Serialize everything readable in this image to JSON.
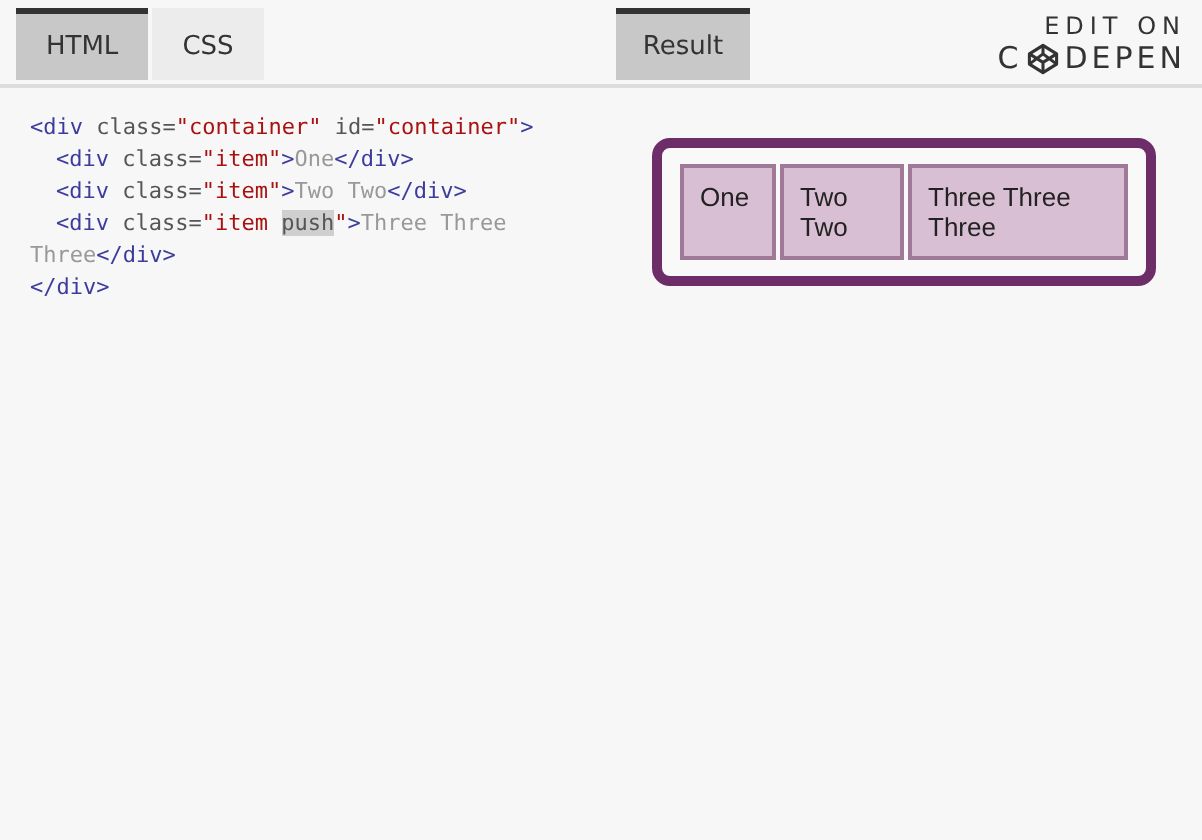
{
  "editor_tabs": [
    {
      "label": "HTML",
      "selected": true
    },
    {
      "label": "CSS",
      "selected": false
    }
  ],
  "result_tab": {
    "label": "Result",
    "selected": true
  },
  "logo": {
    "top": "EDIT ON",
    "left": "C",
    "right": "DEPEN"
  },
  "code_lines": [
    {
      "indent": false,
      "tokens": [
        {
          "kind": "tag",
          "text": "<div"
        },
        {
          "kind": "attr",
          "text": " class="
        },
        {
          "kind": "string",
          "text": "\"container\""
        },
        {
          "kind": "attr",
          "text": " id="
        },
        {
          "kind": "string",
          "text": "\"container\""
        },
        {
          "kind": "tag",
          "text": ">"
        }
      ]
    },
    {
      "indent": true,
      "tokens": [
        {
          "kind": "tag",
          "text": "<div"
        },
        {
          "kind": "attr",
          "text": " class="
        },
        {
          "kind": "string",
          "text": "\"item\""
        },
        {
          "kind": "tag",
          "text": ">"
        },
        {
          "kind": "text",
          "text": "One"
        },
        {
          "kind": "tag",
          "text": "</div>"
        }
      ]
    },
    {
      "indent": true,
      "tokens": [
        {
          "kind": "tag",
          "text": "<div"
        },
        {
          "kind": "attr",
          "text": " class="
        },
        {
          "kind": "string",
          "text": "\"item\""
        },
        {
          "kind": "tag",
          "text": ">"
        },
        {
          "kind": "text",
          "text": "Two Two"
        },
        {
          "kind": "tag",
          "text": "</div>"
        }
      ]
    },
    {
      "indent": true,
      "tokens": [
        {
          "kind": "tag",
          "text": "<div"
        },
        {
          "kind": "attr",
          "text": " class="
        },
        {
          "kind": "string",
          "text": "\"item "
        },
        {
          "kind": "highlight",
          "text": "push"
        },
        {
          "kind": "string",
          "text": "\""
        },
        {
          "kind": "tag",
          "text": ">"
        },
        {
          "kind": "text",
          "text": "Three Three"
        }
      ]
    },
    {
      "indent": false,
      "tokens": [
        {
          "kind": "text",
          "text": "Three"
        },
        {
          "kind": "tag",
          "text": "</div>"
        }
      ]
    },
    {
      "indent": false,
      "tokens": [
        {
          "kind": "tag",
          "text": "</div>"
        }
      ]
    }
  ],
  "result_items": [
    {
      "text": "One"
    },
    {
      "text": "Two Two"
    },
    {
      "text": "Three Three Three"
    }
  ]
}
